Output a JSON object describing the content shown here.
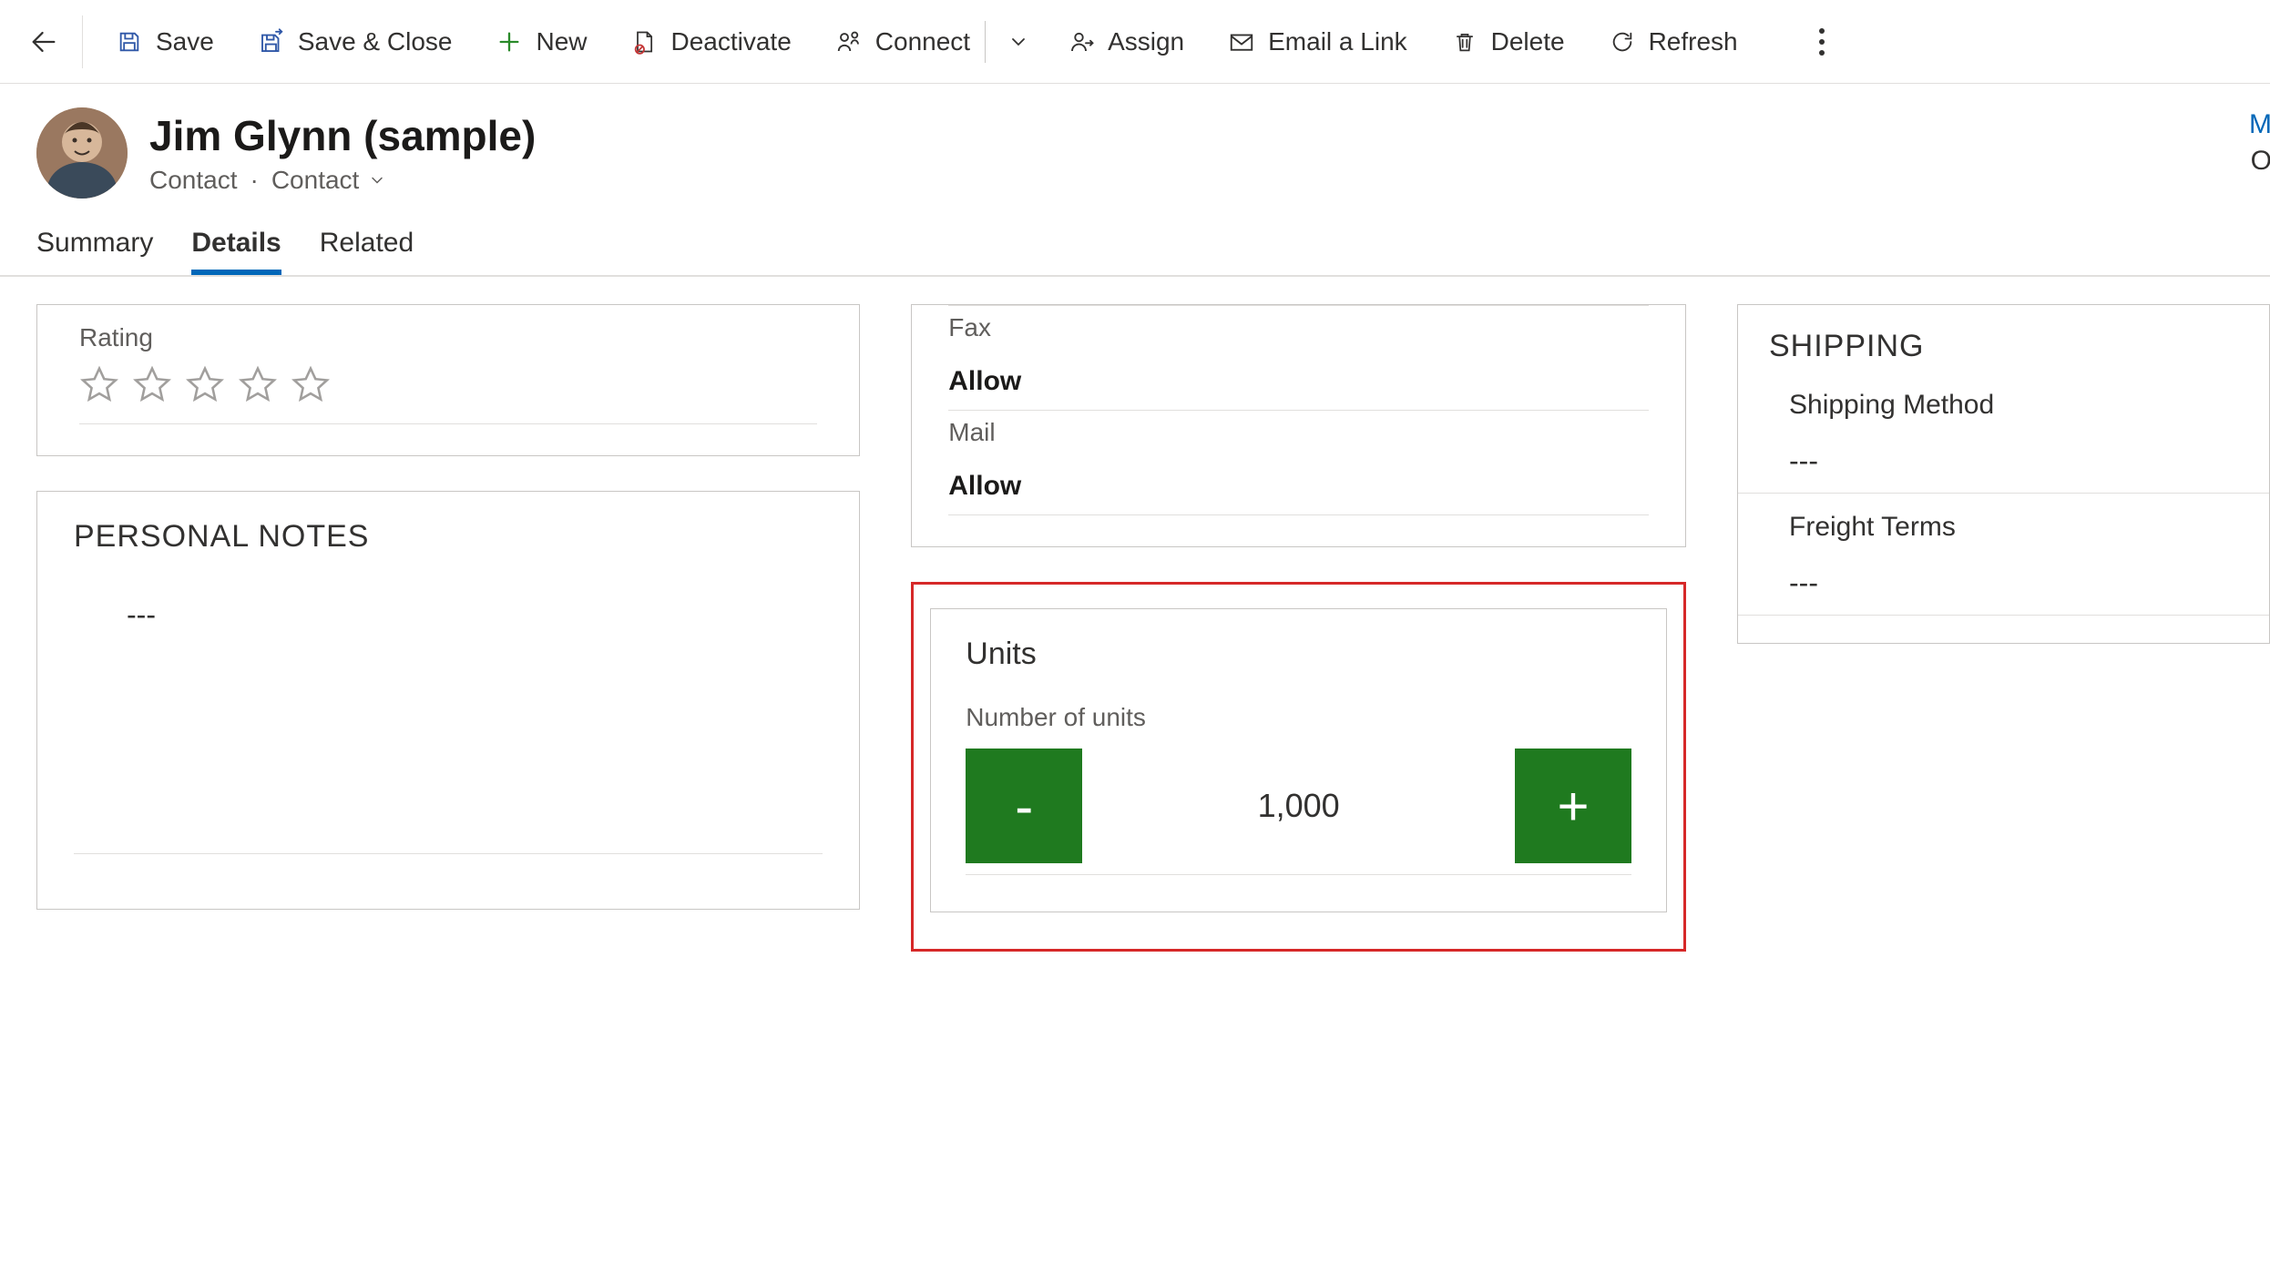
{
  "toolbar": {
    "save": "Save",
    "save_close": "Save & Close",
    "new": "New",
    "deactivate": "Deactivate",
    "connect": "Connect",
    "assign": "Assign",
    "email_link": "Email a Link",
    "delete": "Delete",
    "refresh": "Refresh"
  },
  "header": {
    "title": "Jim Glynn (sample)",
    "entity": "Contact",
    "form": "Contact",
    "right_top": "M",
    "right_bottom": "O"
  },
  "tabs": {
    "summary": "Summary",
    "details": "Details",
    "related": "Related"
  },
  "rating": {
    "label": "Rating"
  },
  "notes": {
    "title": "PERSONAL NOTES",
    "value": "---"
  },
  "prefs": {
    "fax_label": "Fax",
    "fax_value": "Allow",
    "mail_label": "Mail",
    "mail_value": "Allow"
  },
  "units": {
    "title": "Units",
    "label": "Number of units",
    "decrement": "-",
    "value": "1,000",
    "increment": "+"
  },
  "shipping": {
    "title": "SHIPPING",
    "method_label": "Shipping Method",
    "method_value": "---",
    "freight_label": "Freight Terms",
    "freight_value": "---"
  }
}
